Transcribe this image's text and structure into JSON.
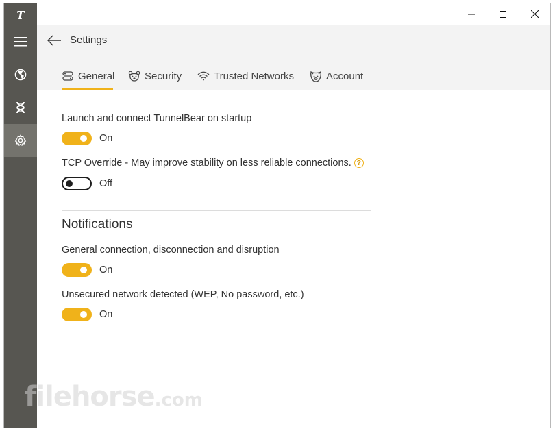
{
  "sidebar": {
    "logo": "T",
    "items": [
      {
        "name": "menu"
      },
      {
        "name": "locations"
      },
      {
        "name": "features"
      },
      {
        "name": "settings",
        "active": true
      }
    ]
  },
  "header": {
    "title": "Settings",
    "tabs": [
      {
        "label": "General",
        "icon": "general-icon",
        "active": true
      },
      {
        "label": "Security",
        "icon": "bear-icon"
      },
      {
        "label": "Trusted Networks",
        "icon": "wifi-icon"
      },
      {
        "label": "Account",
        "icon": "bear-face-icon"
      }
    ]
  },
  "general": {
    "launch_label": "Launch and connect TunnelBear on startup",
    "launch_state": "On",
    "tcp_label": "TCP Override - May improve stability on less reliable connections.",
    "tcp_help": "?",
    "tcp_state": "Off"
  },
  "notifications": {
    "title": "Notifications",
    "general_label": "General connection, disconnection and disruption",
    "general_state": "On",
    "unsecured_label": "Unsecured network detected (WEP, No password, etc.)",
    "unsecured_state": "On"
  },
  "watermark": {
    "text": "filehorse",
    "suffix": ".com"
  },
  "colors": {
    "accent": "#f0b21a",
    "sidebar": "#575651",
    "sidebar_active": "#74736d",
    "header_bg": "#f3f3f3"
  }
}
